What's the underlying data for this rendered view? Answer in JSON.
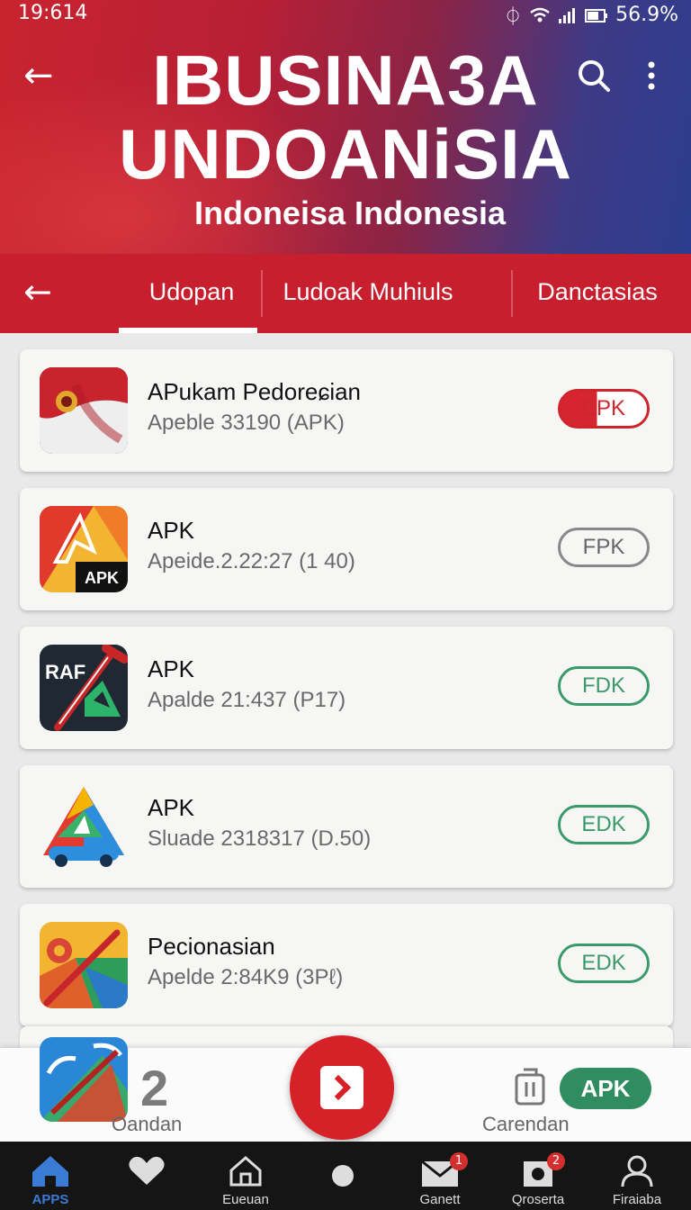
{
  "status_bar": {
    "time": "19:614",
    "battery": "56.9%"
  },
  "header": {
    "title_line1": "IBUSINA3A",
    "title_line2": "UNDOANiSIA",
    "subtitle": "Indoneisa Indonesia"
  },
  "tabs": [
    {
      "label": "Udopan",
      "active": true
    },
    {
      "label": "Ludoak Muhiuls",
      "active": false
    },
    {
      "label": "Danctasias",
      "active": false
    }
  ],
  "apps": [
    {
      "name": "APukam Pedoreɕian",
      "version": "Apeble 33190 (APK)",
      "button": "EPK",
      "button_style": "red",
      "icon": "flag-emblem-icon"
    },
    {
      "name": "APK",
      "version": "Apeide.2.22:27 (1 40)",
      "button": "FPK",
      "button_style": "gray",
      "icon": "apk-red-icon"
    },
    {
      "name": "APK",
      "version": "Apalde 21:437 (P17)",
      "button": "FDK",
      "button_style": "green",
      "icon": "raf-tool-icon"
    },
    {
      "name": "APK",
      "version": "Sluade 2318317 (D.50)",
      "button": "EDK",
      "button_style": "green",
      "icon": "triangle-car-icon"
    },
    {
      "name": "Pecionasian",
      "version": "Apelde 2:84K9 (3Pℓ)",
      "button": "EDK",
      "button_style": "green",
      "icon": "colorful-pen-icon"
    }
  ],
  "float_bar": {
    "count": "2",
    "left_label": "Oandan",
    "right_label": "Carendan",
    "apk_button": "APK"
  },
  "bottom_nav": [
    {
      "label": "APPS",
      "icon": "home-icon",
      "active": true
    },
    {
      "label": "",
      "icon": "heart-icon",
      "active": false
    },
    {
      "label": "Eueuan",
      "icon": "house-outline-icon",
      "active": false
    },
    {
      "label": "",
      "icon": "dot-icon",
      "active": false
    },
    {
      "label": "Ganett",
      "icon": "mail-icon",
      "active": false,
      "badge": "1"
    },
    {
      "label": "Qroserta",
      "icon": "settings-icon",
      "active": false,
      "badge": "2"
    },
    {
      "label": "Firaiaba",
      "icon": "person-icon",
      "active": false
    }
  ],
  "colors": {
    "brand_red": "#c71f2d",
    "accent_green": "#2f8d5f",
    "active_blue": "#3a7bd5"
  }
}
